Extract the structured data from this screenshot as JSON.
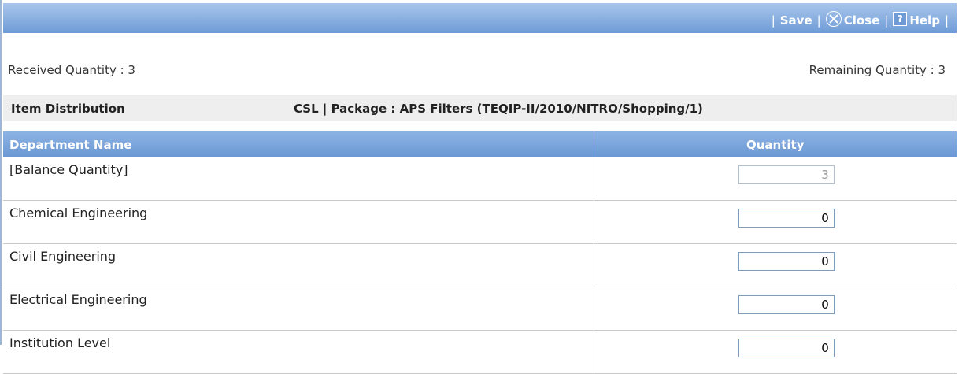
{
  "toolbar": {
    "save_label": "Save",
    "close_label": "Close",
    "help_label": "Help",
    "separator": "|"
  },
  "summary": {
    "received": "Received Quantity : 3",
    "remaining": "Remaining Quantity : 3"
  },
  "section": {
    "title": "Item Distribution",
    "package": "CSL | Package : APS Filters (TEQIP-II/2010/NITRO/Shopping/1)"
  },
  "table": {
    "headers": {
      "department": "Department Name",
      "quantity": "Quantity"
    },
    "rows": [
      {
        "department": "[Balance Quantity]",
        "quantity": "3",
        "editable": false
      },
      {
        "department": "Chemical Engineering",
        "quantity": "0",
        "editable": true
      },
      {
        "department": "Civil Engineering",
        "quantity": "0",
        "editable": true
      },
      {
        "department": "Electrical Engineering",
        "quantity": "0",
        "editable": true
      },
      {
        "department": "Institution Level",
        "quantity": "0",
        "editable": true
      }
    ]
  }
}
